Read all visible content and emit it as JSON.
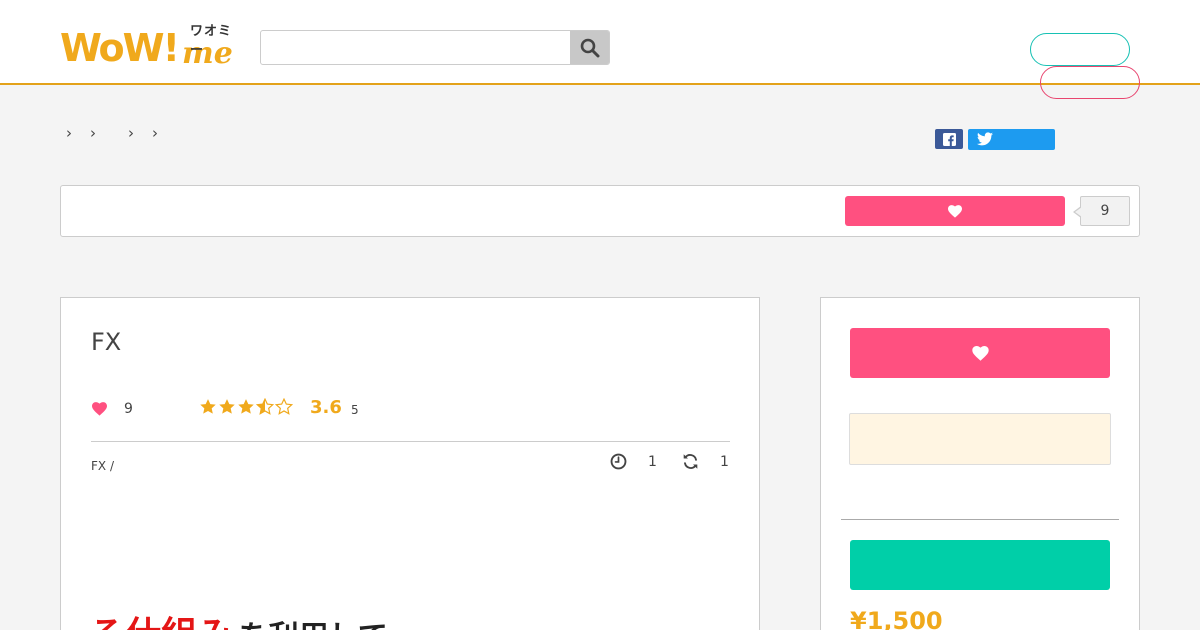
{
  "header": {
    "logo": {
      "text": "WoW!",
      "suffix": "me",
      "kana": "ワオミー"
    },
    "search": {
      "value": "",
      "placeholder": ""
    }
  },
  "breadcrumb": {
    "separators": [
      "›",
      "›",
      "›",
      "›"
    ]
  },
  "favorite_bar": {
    "count": "9"
  },
  "product": {
    "title": "FX",
    "favorites": "9",
    "rating": "3.6",
    "rating_stars": 3.5,
    "review_count": "5",
    "category": "FX /",
    "time": "1",
    "updates": "1",
    "headline_red": "る仕組み",
    "headline_black": "を利用して"
  },
  "sidebar": {
    "price": "¥1,500"
  },
  "colors": {
    "accent": "#f0a91c",
    "favorite": "#ff5080",
    "buy": "#00cfa8",
    "facebook": "#3b5998",
    "twitter": "#1d9bf0"
  },
  "icons": [
    "search-icon",
    "facebook-icon",
    "twitter-icon",
    "heart-icon",
    "star-icon",
    "clock-icon",
    "refresh-icon"
  ]
}
